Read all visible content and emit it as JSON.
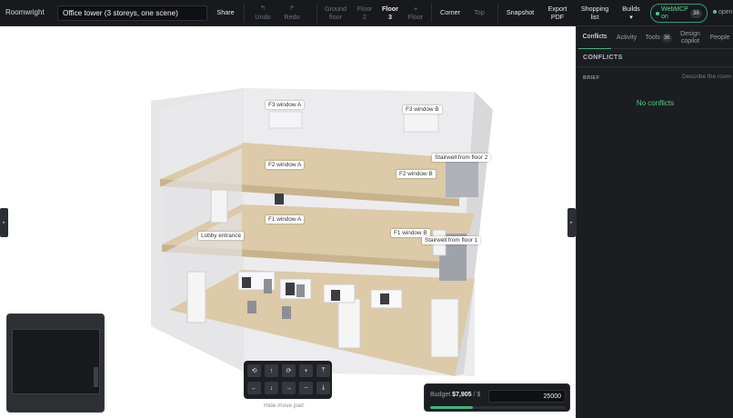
{
  "app": {
    "name": "Roomwright",
    "title": "Office tower (3 storeys, one scene)"
  },
  "toolbar": {
    "share": "Share",
    "undo_icon": "↰",
    "undo": "Undo",
    "redo_icon": "↱",
    "redo": "Redo",
    "ground_floor": [
      "Ground",
      "floor"
    ],
    "floor2": [
      "Floor",
      "2"
    ],
    "floor3": [
      "Floor",
      "3"
    ],
    "add_floor": [
      "+",
      "Floor"
    ],
    "corner": "Corner",
    "top": "Top",
    "snapshot": "Snapshot",
    "export_pdf": [
      "Export",
      "PDF"
    ],
    "shopping_list": [
      "Shopping",
      "list"
    ],
    "builds": [
      "Builds",
      "▾"
    ],
    "webmcp": [
      "WebMCP",
      "on"
    ],
    "webmcp_count": "36",
    "open_status": "open"
  },
  "scene": {
    "labels": {
      "f3a": "F3 window A",
      "f3b": "F3 window B",
      "f2a": "F2 window A",
      "f2b": "F2 window B",
      "stair2": "Stairwell from floor 2",
      "f1a": "F1 window A",
      "f1b": "F1 window B",
      "stair1": "Stairwell from floor 1",
      "lobby": "Lobby entrance"
    },
    "left_toggle": "▸",
    "right_toggle": "▸"
  },
  "movepad": {
    "row1": [
      "⟲",
      "↑",
      "⟳",
      "+",
      "⤒"
    ],
    "row2": [
      "←",
      "↓",
      "→",
      "−",
      "⤓"
    ],
    "hide": "Hide move pad"
  },
  "budget": {
    "label": "Budget",
    "spent": "$7,905",
    "sep": "/ $",
    "limit": "25000",
    "progress": 0.316
  },
  "panel": {
    "tabs": {
      "conflicts": "Conflicts",
      "activity": "Activity",
      "tools": "Tools",
      "tools_count": "36",
      "design_copilot": [
        "Design",
        "copilot"
      ],
      "people": "People"
    },
    "heading": "CONFLICTS",
    "brief_label": "BRIEF",
    "brief_placeholder": "Describe the room",
    "empty": "No conflicts"
  },
  "colors": {
    "accent": "#3fb37d",
    "topbar": "#17191d",
    "panel": "#1b1d21",
    "floor": "#dccaa8",
    "wall": "#e4e4e6"
  }
}
